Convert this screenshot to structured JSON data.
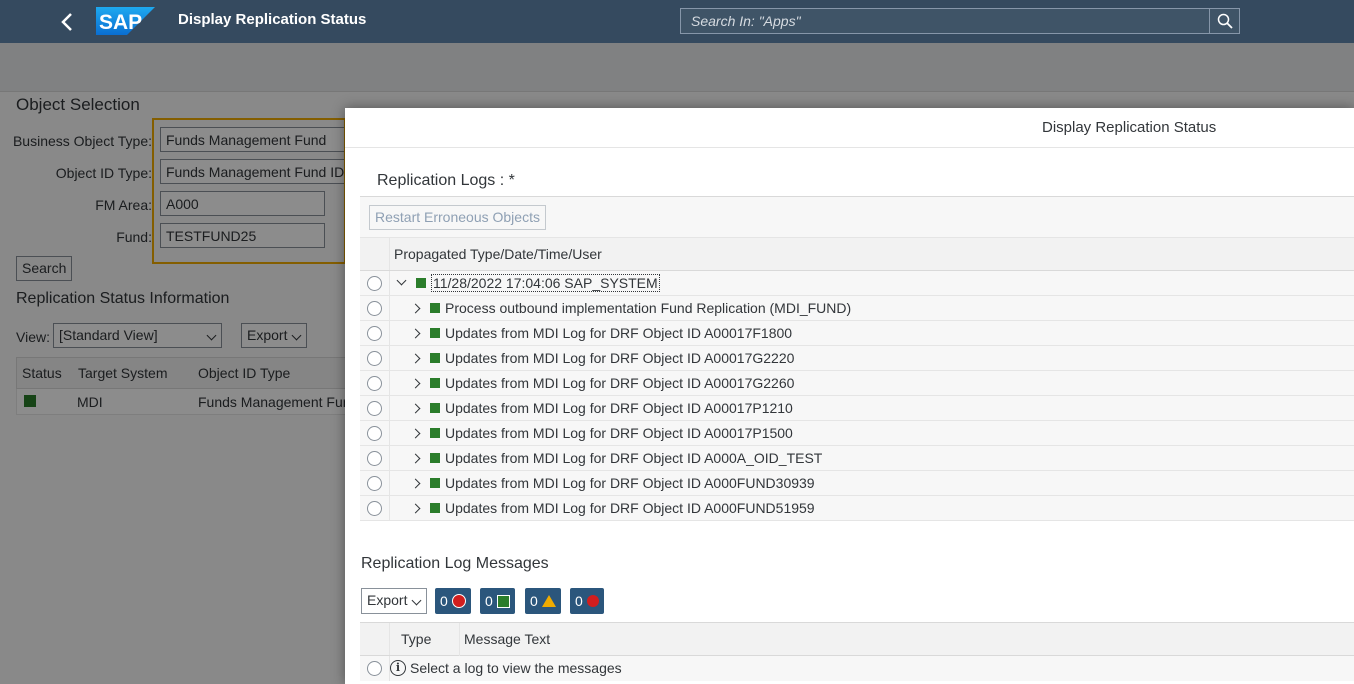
{
  "shell": {
    "title": "Display Replication Status",
    "search_placeholder": "Search In: \"Apps\""
  },
  "background": {
    "object_selection_title": "Object Selection",
    "fields": [
      {
        "label": "Business Object Type:",
        "value": "Funds Management Fund"
      },
      {
        "label": "Object ID Type:",
        "value": "Funds Management Fund ID"
      },
      {
        "label": "FM Area:",
        "value": "A000"
      },
      {
        "label": "Fund:",
        "value": "TESTFUND25"
      }
    ],
    "search_label": "Search",
    "status_info_title": "Replication Status Information",
    "view_label": "View:",
    "view_value": "[Standard View]",
    "export_label": "Export",
    "table": {
      "columns": [
        "Status",
        "Target System",
        "Object ID Type"
      ],
      "rows": [
        {
          "target_system": "MDI",
          "object_id_type": "Funds Management Fund"
        }
      ]
    }
  },
  "dialog": {
    "title": "Display Replication Status",
    "logs_title": "Replication Logs : *",
    "restart_label": "Restart Erroneous Objects",
    "tree_column": "Propagated Type/Date/Time/User",
    "tree_rows": [
      {
        "text": "11/28/2022 17:04:06 SAP_SYSTEM",
        "expanded": true,
        "level": 0
      },
      {
        "text": "Process outbound implementation Fund Replication (MDI_FUND)",
        "expanded": false,
        "level": 1
      },
      {
        "text": "Updates from MDI Log for DRF Object ID A00017F1800",
        "expanded": false,
        "level": 1
      },
      {
        "text": "Updates from MDI Log for DRF Object ID A00017G2220",
        "expanded": false,
        "level": 1
      },
      {
        "text": "Updates from MDI Log for DRF Object ID A00017G2260",
        "expanded": false,
        "level": 1
      },
      {
        "text": "Updates from MDI Log for DRF Object ID A00017P1210",
        "expanded": false,
        "level": 1
      },
      {
        "text": "Updates from MDI Log for DRF Object ID A00017P1500",
        "expanded": false,
        "level": 1
      },
      {
        "text": "Updates from MDI Log for DRF Object ID A000A_OID_TEST",
        "expanded": false,
        "level": 1
      },
      {
        "text": "Updates from MDI Log for DRF Object ID A000FUND30939",
        "expanded": false,
        "level": 1
      },
      {
        "text": "Updates from MDI Log for DRF Object ID A000FUND51959",
        "expanded": false,
        "level": 1
      }
    ],
    "messages_title": "Replication Log Messages",
    "msg_export_label": "Export",
    "counters": [
      {
        "name": "stop",
        "count": "0"
      },
      {
        "name": "success",
        "count": "0"
      },
      {
        "name": "warning",
        "count": "0"
      },
      {
        "name": "error",
        "count": "0"
      }
    ],
    "msg_columns": [
      "Type",
      "Message Text"
    ],
    "msg_placeholder_row": "Select a log to view the messages"
  },
  "colors": {
    "shell_bg": "#354a5f",
    "highlight": "#f0ab00",
    "success_green": "#2b7d2b",
    "counter_btn": "#2b567c"
  }
}
